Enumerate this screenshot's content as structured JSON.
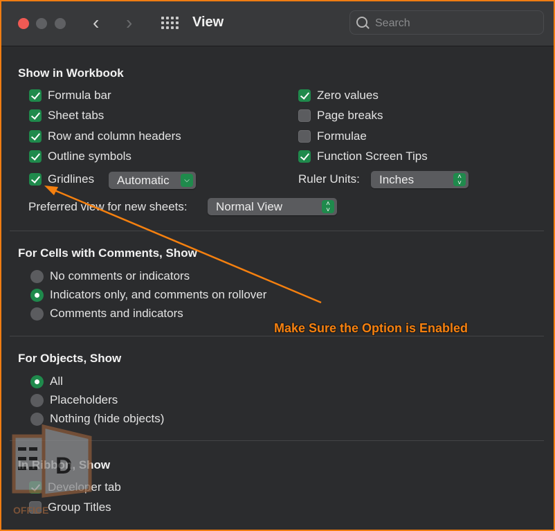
{
  "window": {
    "title": "View",
    "search_placeholder": "Search"
  },
  "show_in_workbook": {
    "title": "Show in Workbook",
    "left": [
      {
        "label": "Formula bar",
        "checked": true
      },
      {
        "label": "Sheet tabs",
        "checked": true
      },
      {
        "label": "Row and column headers",
        "checked": true
      },
      {
        "label": "Outline symbols",
        "checked": true
      },
      {
        "label": "Gridlines",
        "checked": true
      }
    ],
    "right": [
      {
        "label": "Zero values",
        "checked": true
      },
      {
        "label": "Page breaks",
        "checked": false
      },
      {
        "label": "Formulae",
        "checked": false
      },
      {
        "label": "Function Screen Tips",
        "checked": true
      }
    ],
    "gridlines_color": "Automatic",
    "ruler_units_label": "Ruler Units:",
    "ruler_units_value": "Inches",
    "preferred_view_label": "Preferred view for new sheets:",
    "preferred_view_value": "Normal View"
  },
  "comments": {
    "title": "For Cells with Comments, Show",
    "options": [
      {
        "label": "No comments or indicators",
        "selected": false
      },
      {
        "label": "Indicators only, and comments on rollover",
        "selected": true
      },
      {
        "label": "Comments and indicators",
        "selected": false
      }
    ]
  },
  "objects": {
    "title": "For Objects, Show",
    "options": [
      {
        "label": "All",
        "selected": true
      },
      {
        "label": "Placeholders",
        "selected": false
      },
      {
        "label": "Nothing (hide objects)",
        "selected": false
      }
    ]
  },
  "ribbon": {
    "title": "In Ribbon, Show",
    "items": [
      {
        "label": "Developer tab",
        "checked": true
      },
      {
        "label": "Group Titles",
        "checked": false
      }
    ]
  },
  "annotation": {
    "text": "Make Sure the Option is Enabled",
    "color": "#f5800f"
  },
  "watermark": {
    "text": "OFFICE"
  },
  "colors": {
    "accent": "#1f8a4c",
    "close": "#f05a54",
    "frame": "#f07d12"
  }
}
